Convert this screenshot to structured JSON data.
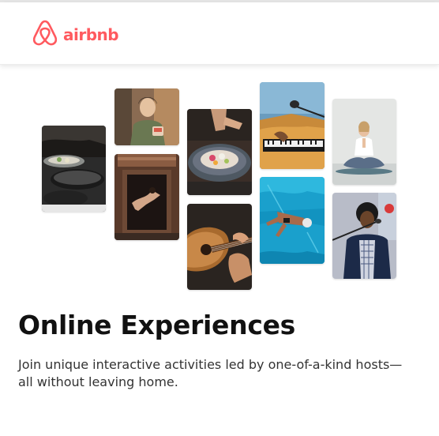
{
  "header": {
    "brand": "airbnb",
    "brand_color": "#ff5a5f"
  },
  "gallery": {
    "images": [
      {
        "name": "cooking-pans-photo",
        "subject": "cooking"
      },
      {
        "name": "woman-holding-cup-photo",
        "subject": "host portrait"
      },
      {
        "name": "dancer-doorway-photo",
        "subject": "dance"
      },
      {
        "name": "food-bowl-photo",
        "subject": "food plating"
      },
      {
        "name": "guitar-playing-photo",
        "subject": "guitar"
      },
      {
        "name": "keyboard-microphone-photo",
        "subject": "music"
      },
      {
        "name": "swimmer-pool-photo",
        "subject": "swimming"
      },
      {
        "name": "meditation-pose-photo",
        "subject": "yoga"
      },
      {
        "name": "singer-microphone-photo",
        "subject": "singing"
      }
    ]
  },
  "main": {
    "title": "Online Experiences",
    "subtitle": "Join unique interactive activities led by one-of-a-kind hosts—all without leaving home."
  }
}
